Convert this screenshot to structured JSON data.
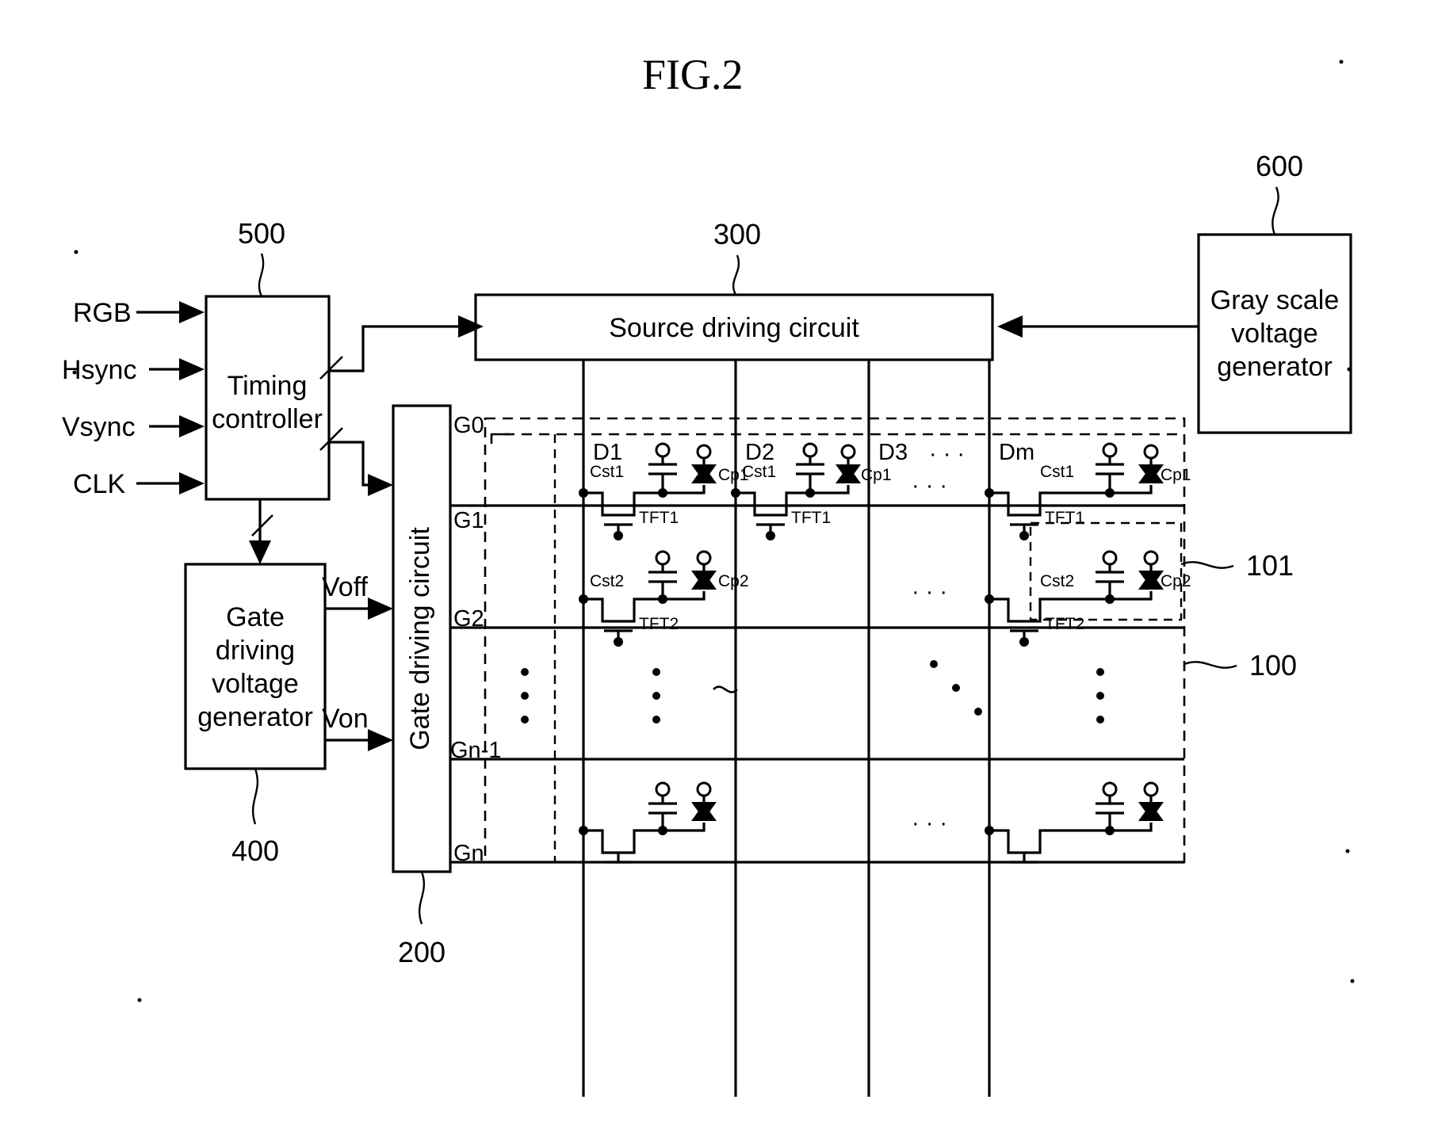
{
  "figure": {
    "title": "FIG.2"
  },
  "inputs": [
    {
      "label": "RGB"
    },
    {
      "label": "Hsync"
    },
    {
      "label": "Vsync"
    },
    {
      "label": "CLK"
    }
  ],
  "blocks": {
    "timing_controller": {
      "label_line1": "Timing",
      "label_line2": "controller",
      "ref": "500"
    },
    "gate_driving_voltage_generator": {
      "label_line1": "Gate",
      "label_line2": "driving",
      "label_line3": "voltage",
      "label_line4": "generator",
      "ref": "400"
    },
    "gate_driving_circuit": {
      "label": "Gate driving circuit",
      "ref": "200"
    },
    "source_driving_circuit": {
      "label": "Source driving circuit",
      "ref": "300"
    },
    "gray_scale_voltage_generator": {
      "label_line1": "Gray scale",
      "label_line2": "voltage",
      "label_line3": "generator",
      "ref": "600"
    },
    "panel": {
      "ref": "100"
    },
    "pixel": {
      "ref": "101"
    }
  },
  "voltage_signals": [
    {
      "label": "Voff"
    },
    {
      "label": "Von"
    }
  ],
  "data_lines": [
    {
      "label": "D1"
    },
    {
      "label": "D2"
    },
    {
      "label": "D3"
    },
    {
      "label": "·  ·  ·"
    },
    {
      "label": "Dm"
    }
  ],
  "gate_lines": [
    {
      "label": "G0"
    },
    {
      "label": "G1"
    },
    {
      "label": "G2"
    },
    {
      "label": "Gn-1"
    },
    {
      "label": "Gn"
    }
  ],
  "components": {
    "row1": {
      "cst": "Cst1",
      "cp": "Cp1",
      "tft": "TFT1"
    },
    "row2": {
      "cst": "Cst2",
      "cp": "Cp2",
      "tft": "TFT2"
    }
  },
  "ellipsis": {
    "horizontal": "·  ·  ·",
    "vertical": "·"
  },
  "colors": {
    "ink": "#000000",
    "paper": "#ffffff"
  }
}
